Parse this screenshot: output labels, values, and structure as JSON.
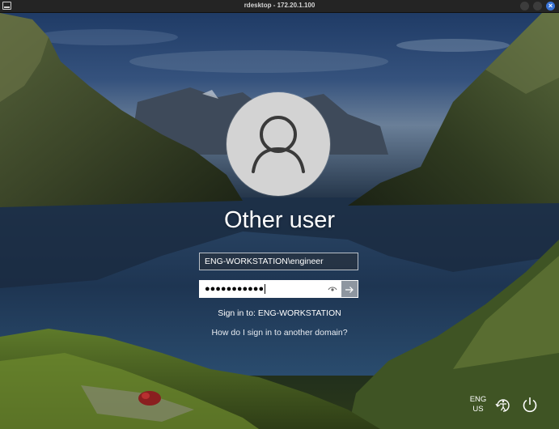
{
  "window": {
    "title": "rdesktop - 172.20.1.100"
  },
  "login": {
    "user_display_name": "Other user",
    "username_value": "ENG-WORKSTATION\\engineer",
    "password_masked": "●●●●●●●●●●●",
    "sign_in_to": "Sign in to: ENG-WORKSTATION",
    "other_domain_link": "How do I sign in to another domain?"
  },
  "taskbar": {
    "language_line1": "ENG",
    "language_line2": "US"
  },
  "icons": {
    "app": "monitor-icon",
    "avatar": "user-silhouette-icon",
    "reveal": "eye-icon",
    "submit": "arrow-right-icon",
    "accessibility": "ease-of-access-icon",
    "power": "power-icon"
  },
  "colors": {
    "close_button": "#3a74d6",
    "password_field": "#ffffff",
    "submit_button": "#8e96a0"
  }
}
